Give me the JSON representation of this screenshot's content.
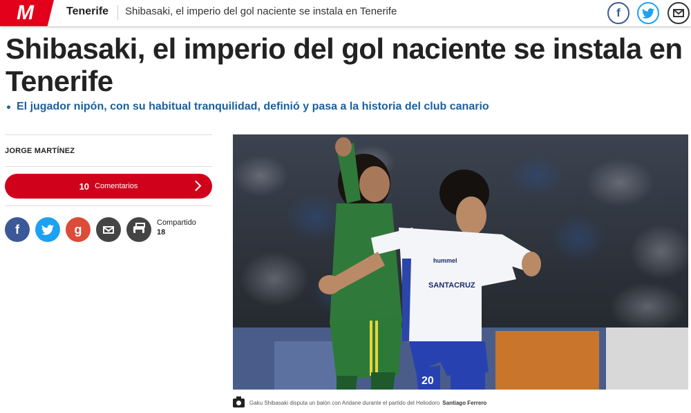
{
  "header": {
    "logo_letter": "M",
    "section": "Tenerife",
    "title": "Shibasaki, el imperio del gol naciente se instala en Tenerife",
    "share": {
      "facebook_glyph": "f",
      "twitter_icon": "twitter-icon",
      "mail_icon": "mail-icon"
    }
  },
  "article": {
    "headline": "Shibasaki, el imperio del gol naciente se instala en Tenerife",
    "subtitle": "El jugador nipón, con su habitual tranquilidad, definió y pasa a la historia del club canario",
    "author": "JORGE MARTÍNEZ",
    "comments": {
      "count": "10",
      "label": "Comentarios"
    },
    "share": {
      "facebook_glyph": "f",
      "googleplus_glyph": "g",
      "shared_label": "Compartido",
      "shared_count": "18"
    },
    "photo": {
      "caption": "Gaku Shibasaki disputa un balón con Aridane durante el partido del Heliodoro",
      "credit": "Santiago Ferrero",
      "shirt_sponsor": "SANTACRUZ",
      "shirt_brand": "hummel",
      "shirt_number": "20"
    }
  },
  "colors": {
    "brand_red": "#e2001a",
    "comments_red": "#d0021b",
    "subtitle_blue": "#1a5f9e",
    "facebook": "#3b5998",
    "twitter": "#1da1f2",
    "googleplus": "#dd4b39"
  }
}
